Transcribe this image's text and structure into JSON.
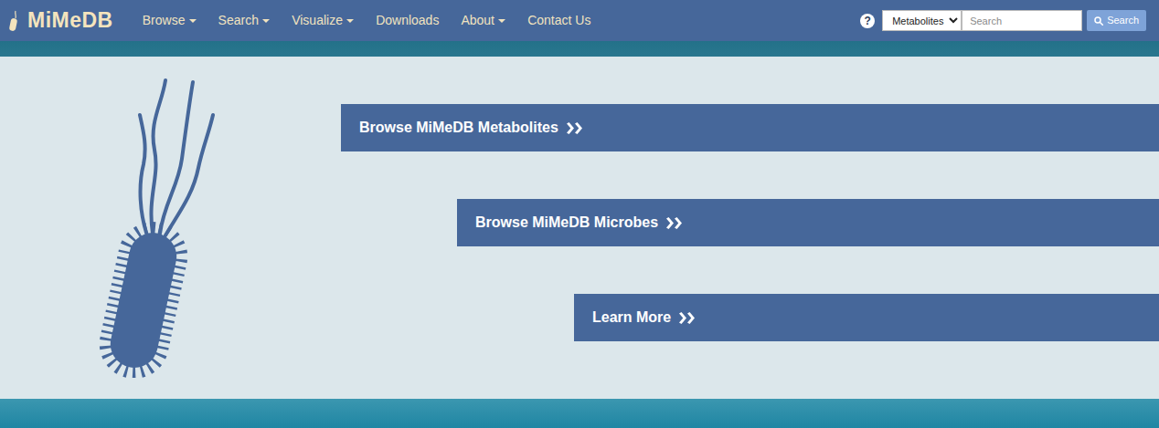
{
  "brand": {
    "name": "MiMeDB"
  },
  "nav": [
    {
      "label": "Browse",
      "has_menu": true
    },
    {
      "label": "Search",
      "has_menu": true
    },
    {
      "label": "Visualize",
      "has_menu": true
    },
    {
      "label": "Downloads",
      "has_menu": false
    },
    {
      "label": "About",
      "has_menu": true
    },
    {
      "label": "Contact Us",
      "has_menu": false
    }
  ],
  "help": "?",
  "search": {
    "category": "Metabolites",
    "placeholder": "Search",
    "button": "Search"
  },
  "links": [
    {
      "label": "Browse MiMeDB Metabolites"
    },
    {
      "label": "Browse MiMeDB Microbes"
    },
    {
      "label": "Learn More"
    }
  ]
}
